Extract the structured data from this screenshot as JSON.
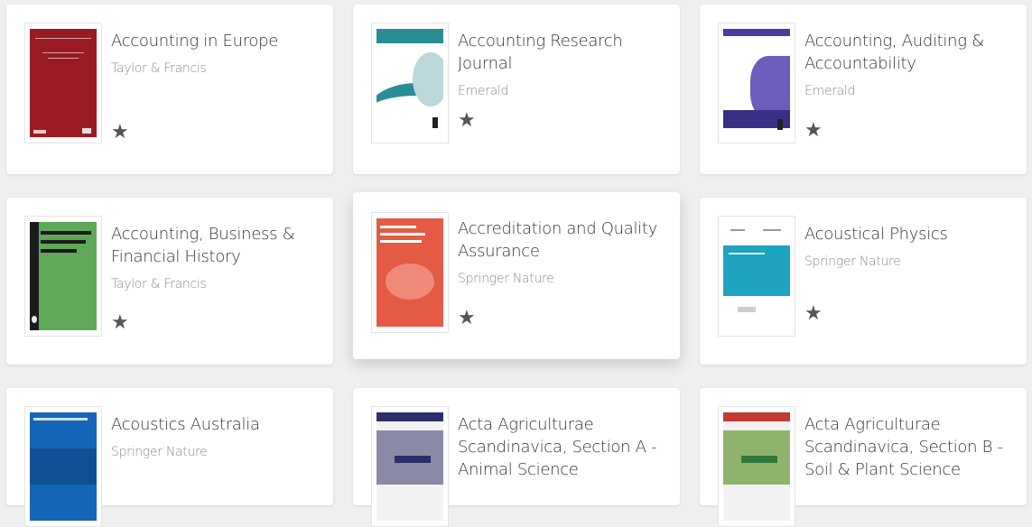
{
  "journals": [
    {
      "title": "Accounting in Europe",
      "publisher": "Taylor & Francis",
      "cover_color": "#9b1b24",
      "favorite_icon": "star-icon"
    },
    {
      "title": "Accounting Research Journal",
      "publisher": "Emerald",
      "cover_color": "#2a8c95",
      "favorite_icon": "star-icon"
    },
    {
      "title": "Accounting, Auditing & Accountability",
      "publisher": "Emerald",
      "cover_color": "#4a3c9a",
      "favorite_icon": "star-icon"
    },
    {
      "title": "Accounting, Business & Financial History",
      "publisher": "Taylor & Francis",
      "cover_color": "#5fa858",
      "favorite_icon": "star-icon"
    },
    {
      "title": "Accreditation and Quality Assurance",
      "publisher": "Springer Nature",
      "cover_color": "#e55a44",
      "favorite_icon": "star-icon"
    },
    {
      "title": "Acoustical Physics",
      "publisher": "Springer Nature",
      "cover_color": "#1ea4c0",
      "favorite_icon": "star-icon"
    },
    {
      "title": "Acoustics Australia",
      "publisher": "Springer Nature",
      "cover_color": "#1565b8",
      "favorite_icon": "star-icon"
    },
    {
      "title": "Acta Agriculturae Scandinavica, Section A - Animal Science",
      "publisher": "",
      "cover_color": "#2d2f6b",
      "favorite_icon": "star-icon"
    },
    {
      "title": "Acta Agriculturae Scandinavica, Section B - Soil & Plant Science",
      "publisher": "",
      "cover_color": "#2f7a3a",
      "favorite_icon": "star-icon"
    }
  ]
}
